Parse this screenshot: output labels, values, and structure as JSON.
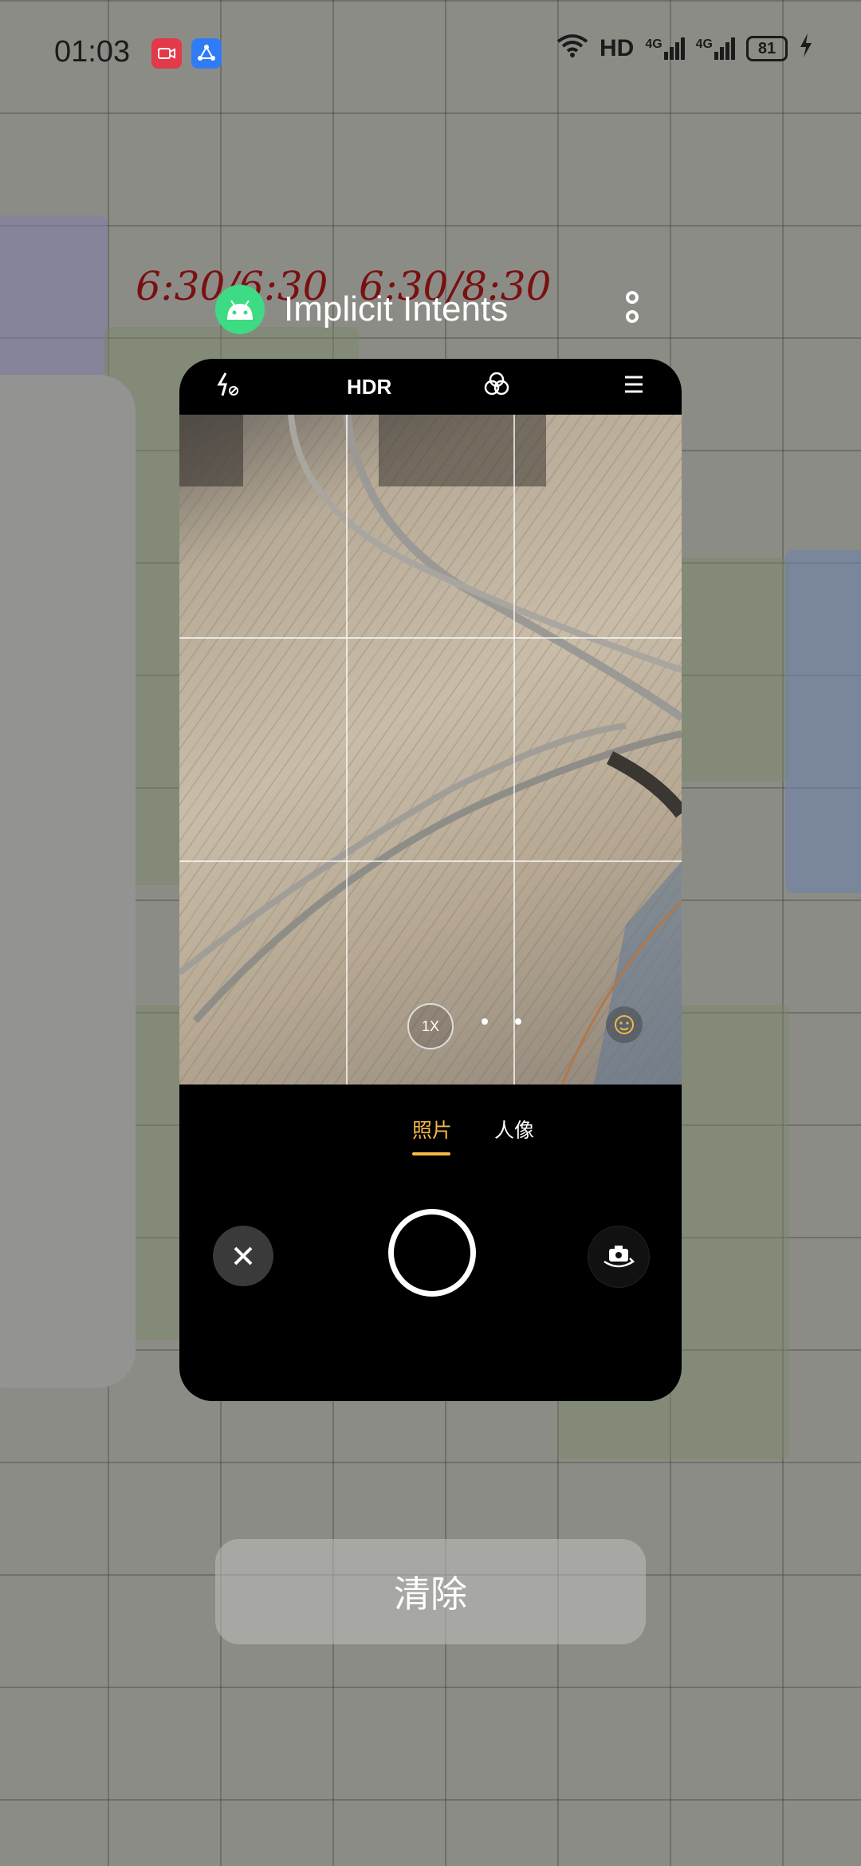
{
  "status_bar": {
    "time": "01:03",
    "network_label": "HD",
    "signal_1": "4G",
    "signal_2": "4G",
    "battery": "81",
    "app_icons": [
      "screen-record-icon",
      "share-nodes-icon"
    ],
    "colors": {
      "record": "#e2394b",
      "share": "#2f7cf6"
    }
  },
  "recent_app": {
    "title": "Implicit Intents",
    "icon": "android-icon",
    "icon_color": "#3ddc84"
  },
  "camera": {
    "toolbar": [
      "flash-off-icon",
      "HDR",
      "filter-icon",
      "menu-icon"
    ],
    "hdr_label": "HDR",
    "zoom_label": "1X",
    "modes": [
      {
        "label": "照片",
        "active": true
      },
      {
        "label": "人像",
        "active": false
      }
    ],
    "accent_color": "#f3b847"
  },
  "wallpaper_text": {
    "time_range_1": "6:30/6:30",
    "time_range_2": "6:30/8:30"
  },
  "actions": {
    "clear_label": "清除"
  }
}
